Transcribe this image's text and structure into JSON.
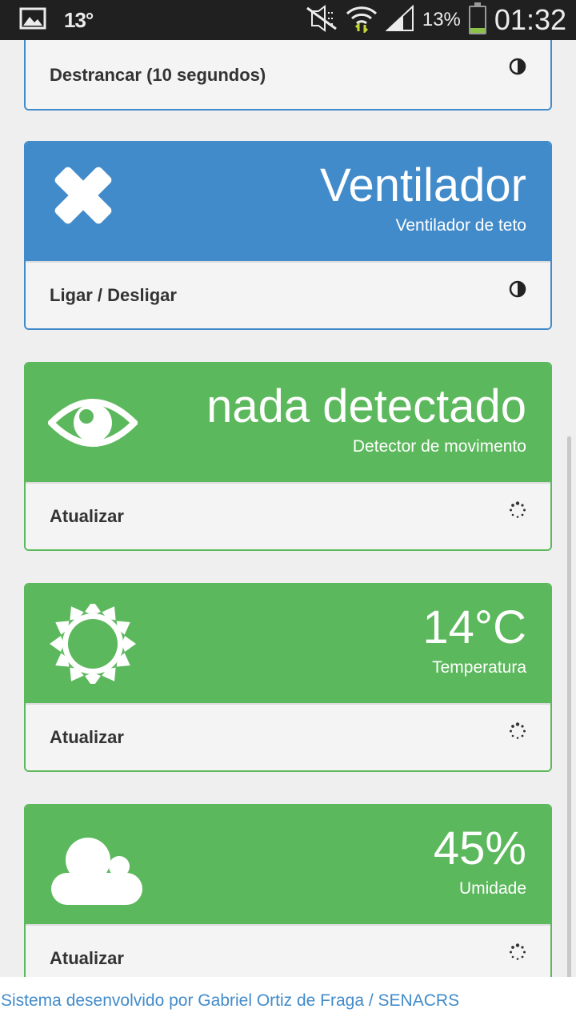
{
  "statusbar": {
    "temperature": "13°",
    "battery_percent": "13%",
    "clock": "01:32",
    "icons": [
      "image-icon",
      "mute-icon",
      "wifi-icon",
      "signal-icon",
      "battery-icon"
    ]
  },
  "cards": [
    {
      "footer_label": "Destrancar (10 segundos)",
      "footer_icon": "contrast-icon",
      "color": "#428bca"
    },
    {
      "value": "Ventilador",
      "subtitle": "Ventilador de teto",
      "icon": "fan-cross-icon",
      "footer_label": "Ligar / Desligar",
      "footer_icon": "contrast-icon",
      "color": "#428bca"
    },
    {
      "value": "nada detectado",
      "subtitle": "Detector de movimento",
      "icon": "eye-icon",
      "footer_label": "Atualizar",
      "footer_icon": "spinner-icon",
      "color": "#5cb85c"
    },
    {
      "value": "14°C",
      "subtitle": "Temperatura",
      "icon": "sun-icon",
      "footer_label": "Atualizar",
      "footer_icon": "spinner-icon",
      "color": "#5cb85c"
    },
    {
      "value": "45%",
      "subtitle": "Umidade",
      "icon": "cloud-icon",
      "footer_label": "Atualizar",
      "footer_icon": "spinner-icon",
      "color": "#5cb85c"
    }
  ],
  "footer": {
    "text": "Sistema desenvolvido por Gabriel Ortiz de Fraga / SENACRS"
  }
}
